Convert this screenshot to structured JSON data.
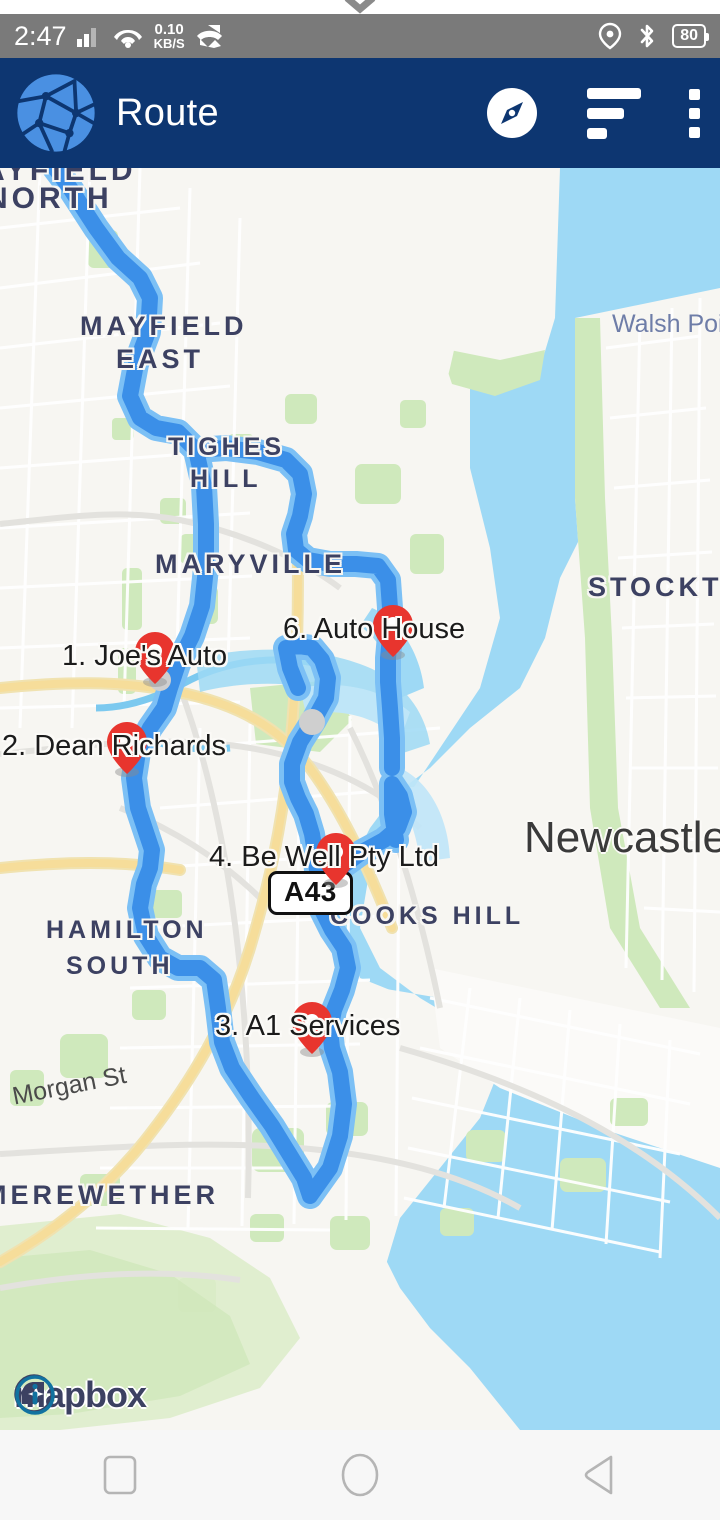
{
  "status_bar": {
    "time": "2:47",
    "net_speed_value": "0.10",
    "net_speed_unit": "KB/S",
    "battery_level": "80",
    "icons": [
      "signal-icon",
      "wifi-icon",
      "missed-call-icon",
      "location-icon",
      "bluetooth-icon",
      "battery-icon"
    ],
    "background": "#7a7a7a"
  },
  "app_bar": {
    "title": "Route",
    "background": "#0d3671",
    "logo_name": "globe-logo",
    "actions": [
      {
        "name": "compass-button",
        "icon": "compass-icon"
      },
      {
        "name": "sort-button",
        "icon": "sort-icon"
      },
      {
        "name": "overflow-menu-button",
        "icon": "kebab-icon"
      }
    ]
  },
  "map": {
    "provider": "mapbox",
    "attribution_text": "mapbox",
    "info_label": "i",
    "colors": {
      "water": "#9ed9f5",
      "land": "#f7f6f2",
      "park": "#c7e7b4",
      "route": "#3b8fe8",
      "route_casing": "#7cc0f5",
      "highway": "#f6dd9a",
      "marker": "#e8352e"
    },
    "road_shield": "A43",
    "place_labels": [
      {
        "text": "MAYFIELD NORTH",
        "line1": "MAYFIELD",
        "line2": "NORTH"
      },
      {
        "text": "MAYFIELD EAST",
        "line1": "MAYFIELD",
        "line2": "EAST"
      },
      {
        "text": "TIGHES HILL",
        "line1": "TIGHES",
        "line2": "HILL"
      },
      {
        "text": "MARYVILLE"
      },
      {
        "text": "STOCKTON"
      },
      {
        "text": "HAMILTON SOUTH",
        "line1": "HAMILTON",
        "line2": "SOUTH"
      },
      {
        "text": "COOKS HILL"
      },
      {
        "text": "MEREWETHER"
      }
    ],
    "city_labels": [
      {
        "text": "Newcastle"
      }
    ],
    "water_labels": [
      {
        "text": "Walsh Point"
      }
    ],
    "street_labels": [
      {
        "text": "Morgan St"
      }
    ],
    "stops": [
      {
        "index": "1",
        "label": "1. Joe's Auto"
      },
      {
        "index": "2",
        "label": "2. Dean Richards"
      },
      {
        "index": "3",
        "label": "3. A1 Services"
      },
      {
        "index": "4",
        "label": "4. Be Well Pty Ltd"
      },
      {
        "index": "6",
        "label": "6. Auto House"
      }
    ]
  },
  "nav_bar": {
    "buttons": [
      {
        "name": "recents-button",
        "icon": "square-icon"
      },
      {
        "name": "home-button",
        "icon": "circle-icon"
      },
      {
        "name": "back-button",
        "icon": "triangle-left-icon"
      }
    ]
  }
}
